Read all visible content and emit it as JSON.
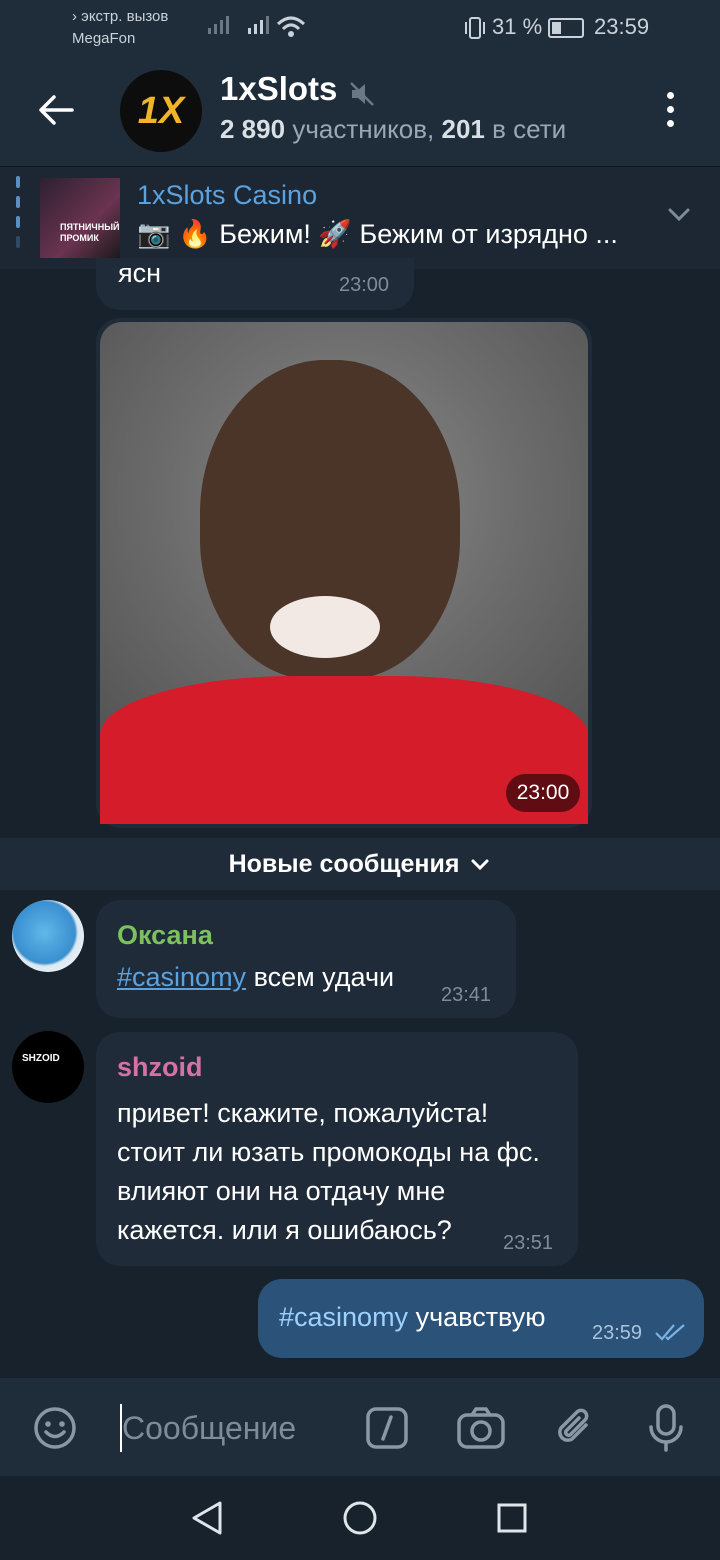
{
  "status_bar": {
    "carrier_line1": "› экстр. вызов",
    "carrier_line2": "MegaFon",
    "battery": "31 %",
    "time": "23:59"
  },
  "header": {
    "title": "1xSlots",
    "avatar_text": "1X",
    "subtitle_members": "2 890",
    "subtitle_members_label": "участников,",
    "subtitle_online": "201",
    "subtitle_online_label": "в сети"
  },
  "pinned": {
    "thumb_text": "ПЯТНИЧНЫЙ ПРОМИК",
    "title": "1xSlots Casino",
    "text": "📷 🔥 Бежим! 🚀 Бежим от изрядно ..."
  },
  "messages": {
    "partial": {
      "text": "ясн",
      "time": "23:00"
    },
    "media": {
      "time": "23:00"
    },
    "divider": "Новые сообщения",
    "msg1": {
      "author": "Оксана",
      "hashtag": "#casinomy",
      "text": " всем удачи",
      "time": "23:41"
    },
    "msg2": {
      "author": "shzoid",
      "avatar_text": "SHZOID",
      "text": "привет! скажите, пожалуйста! стоит ли юзать промокоды на фс. влияют они на отдачу мне кажется. или я ошибаюсь?",
      "time": "23:51"
    },
    "msg3": {
      "hashtag": "#casinomy",
      "text": " учавствую",
      "time": "23:59"
    }
  },
  "input": {
    "placeholder": "Сообщение"
  },
  "colors": {
    "accent": "#5ba3e0",
    "background": "#18222d",
    "bubble_in": "#1f2b38",
    "bubble_out": "#2b5278"
  }
}
